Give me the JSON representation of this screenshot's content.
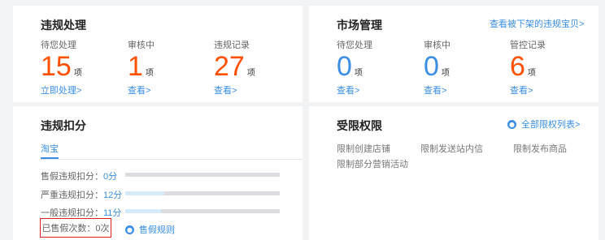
{
  "violation": {
    "title": "违规处理",
    "stats": [
      {
        "label": "待您处理",
        "value": "15",
        "unit": "项",
        "link": "立即处理>"
      },
      {
        "label": "审核中",
        "value": "1",
        "unit": "项",
        "link": "查看>"
      },
      {
        "label": "违规记录",
        "value": "27",
        "unit": "项",
        "link": "查看>"
      }
    ]
  },
  "market": {
    "title": "市场管理",
    "top_link": "查看被下架的违规宝贝>",
    "stats": [
      {
        "label": "待您处理",
        "value": "0",
        "unit": "项",
        "link": "查看>"
      },
      {
        "label": "审核中",
        "value": "0",
        "unit": "项",
        "link": "查看>"
      },
      {
        "label": "管控记录",
        "value": "6",
        "unit": "项",
        "link": "查看>"
      }
    ]
  },
  "deduction": {
    "title": "违规扣分",
    "tab": "淘宝",
    "rows": [
      {
        "label": "售假违规扣分：",
        "value": "0分",
        "progress": 0
      },
      {
        "label": "严重违规扣分：",
        "value": "12分",
        "progress": 0.25
      },
      {
        "label": "一般违规扣分：",
        "value": "11分",
        "progress": 0.23
      }
    ],
    "sold_count": "已售假次数：0次",
    "sold_rule": "售假规则"
  },
  "restriction": {
    "title": "受限权限",
    "list_link": "全部限权列表>",
    "items": [
      "限制创建店铺",
      "限制发送站内信",
      "限制发布商品",
      "限制部分营销活动"
    ]
  },
  "colors": {
    "accent_orange": "#ff5000",
    "accent_blue": "#3a8ee6",
    "highlight_red": "#e02020"
  },
  "icons": {
    "info": "info-icon"
  }
}
